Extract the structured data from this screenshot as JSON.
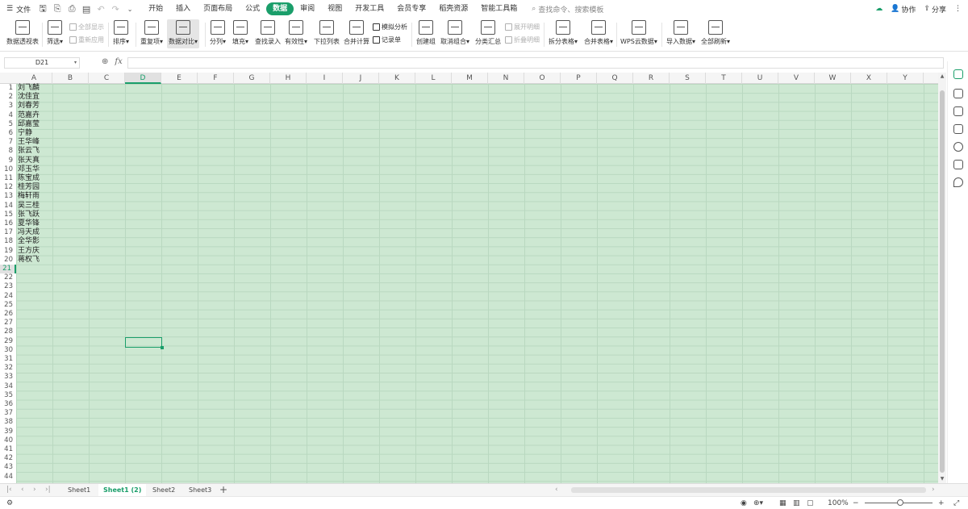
{
  "titlebar": {
    "file_menu": "文件",
    "tabs": [
      "开始",
      "插入",
      "页面布局",
      "公式",
      "数据",
      "审阅",
      "视图",
      "开发工具",
      "会员专享",
      "稻壳资源",
      "智能工具箱"
    ],
    "active_tab_index": 4,
    "search_placeholder": "查找命令、搜索模板",
    "collab": "协作",
    "share": "分享"
  },
  "ribbon": {
    "pivot": "数据透视表",
    "filter": "筛选",
    "show_all": "全部显示",
    "reapply": "重新应用",
    "sort": "排序",
    "duplicates": "重复项",
    "compare": "数据对比",
    "split": "分列",
    "fill": "填充",
    "lookup": "查找录入",
    "validity": "有效性",
    "dropdown": "下拉列表",
    "merge_calc": "合并计算",
    "simulate": "模拟分析",
    "record": "记录单",
    "create_group": "创建组",
    "ungroup": "取消组合",
    "subtotal": "分类汇总",
    "expand": "展开明细",
    "collapse": "折叠明细",
    "split_table": "拆分表格",
    "merge_table": "合并表格",
    "wps_cloud": "WPS云数据",
    "import": "导入数据",
    "refresh_all": "全部刷新"
  },
  "formula_bar": {
    "cell_ref": "D21",
    "fx": "fx",
    "value": ""
  },
  "columns": [
    "A",
    "B",
    "C",
    "D",
    "E",
    "F",
    "G",
    "H",
    "I",
    "J",
    "K",
    "L",
    "M",
    "N",
    "O",
    "P",
    "Q",
    "R",
    "S",
    "T",
    "U",
    "V",
    "W",
    "X",
    "Y"
  ],
  "selected_column": "D",
  "selected_row": 21,
  "row_count": 44,
  "names": [
    "刘飞麟",
    "沈佳宜",
    "刘春芳",
    "范嘉卉",
    "邱嘉莹",
    "宁静",
    "王华峰",
    "张云飞",
    "张天真",
    "邓玉华",
    "陈宝成",
    "桂芳园",
    "梅轩雨",
    "吴三桂",
    "张飞跃",
    "夏华锋",
    "冯天成",
    "全华影",
    "王方庆",
    "蒋权飞"
  ],
  "sheets": [
    "Sheet1",
    "Sheet1 (2)",
    "Sheet2",
    "Sheet3"
  ],
  "active_sheet_index": 1,
  "status": {
    "zoom": "100%"
  },
  "colors": {
    "accent": "#1a9e6a",
    "cell_fill": "#cde8d2"
  }
}
